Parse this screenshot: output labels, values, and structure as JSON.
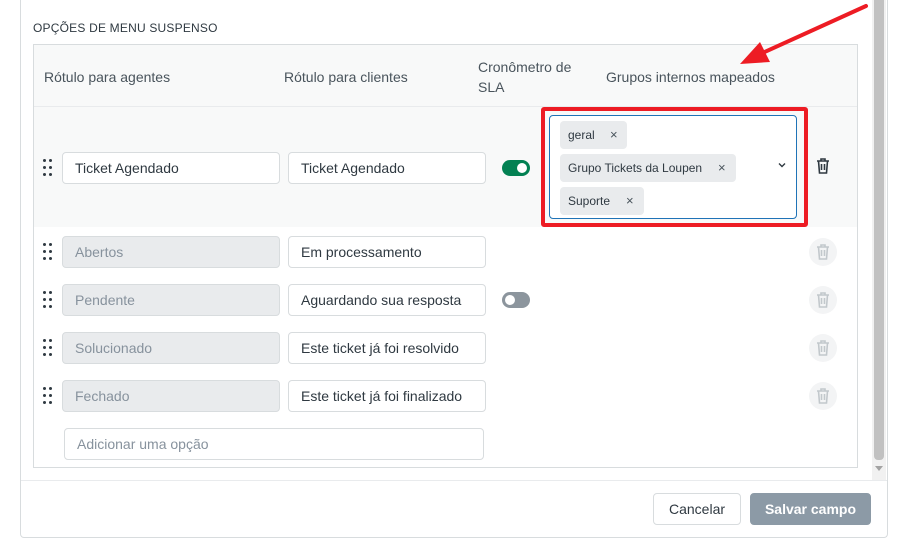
{
  "section": {
    "title": "OPÇÕES DE MENU SUSPENSO"
  },
  "table": {
    "headers": {
      "agent_label": "Rótulo para agentes",
      "client_label": "Rótulo para clientes",
      "sla_line1": "Cronômetro de",
      "sla_line2": "SLA",
      "groups": "Grupos internos mapeados"
    },
    "rows": [
      {
        "agent_value": "Ticket Agendado",
        "client_value": "Ticket Agendado",
        "sla": "on"
      },
      {
        "agent_value": "Abertos",
        "client_value": "Em processamento",
        "sla": "none"
      },
      {
        "agent_value": "Pendente",
        "client_value": "Aguardando sua resposta",
        "sla": "off"
      },
      {
        "agent_value": "Solucionado",
        "client_value": "Este ticket já foi resolvido",
        "sla": "none"
      },
      {
        "agent_value": "Fechado",
        "client_value": "Este ticket já foi finalizado",
        "sla": "none"
      }
    ],
    "groups_tags": [
      "geral",
      "Grupo Tickets da Loupen",
      "Suporte"
    ],
    "tag_remove_glyph": "×",
    "add_option_placeholder": "Adicionar uma opção"
  },
  "footer": {
    "cancel_label": "Cancelar",
    "save_label": "Salvar campo"
  },
  "icons": {
    "drag": "drag-handle-icon",
    "trash": "trash-icon",
    "chevron": "chevron-down-icon",
    "tag_remove": "close-icon"
  },
  "colors": {
    "toggle_on": "#038153",
    "toggle_off": "#8c959d",
    "focus_border": "#1f73b7",
    "annotation_red": "#ed1c24",
    "save_button": "#8c9aa6"
  }
}
